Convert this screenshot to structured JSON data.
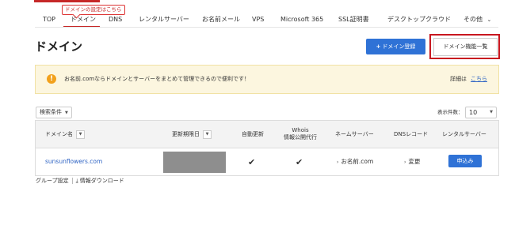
{
  "tooltip": {
    "text": "ドメインの設定はこちら"
  },
  "nav": {
    "items": [
      {
        "label": "TOP"
      },
      {
        "label": "ドメイン"
      },
      {
        "label": "DNS"
      },
      {
        "label": "レンタルサーバー"
      },
      {
        "label": "お名前メール"
      },
      {
        "label": "VPS"
      },
      {
        "label": "Microsoft 365"
      },
      {
        "label": "SSL証明書"
      },
      {
        "label": "デスクトップクラウド"
      },
      {
        "label": "その他"
      }
    ],
    "more_caret": "⌄",
    "active_color": "#c62828"
  },
  "page": {
    "title": "ドメイン"
  },
  "actions": {
    "register_label": "ドメイン登録",
    "register_icon": "plus-icon",
    "functions_label": "ドメイン機能一覧",
    "primary_color": "#2f72d6"
  },
  "notice": {
    "icon": "info-icon",
    "text": "お名前.comならドメインとサーバーをまとめて管理できるので便利です！",
    "detail_prefix": "詳細は",
    "detail_link": "こちら"
  },
  "filter": {
    "label": "検索条件"
  },
  "pagination": {
    "per_page_label": "表示件数：",
    "per_page_value": "10"
  },
  "table": {
    "columns": {
      "domain": "ドメイン名",
      "expiry": "更新期限日",
      "auto_renew": "自動更新",
      "whois_line1": "Whois",
      "whois_line2": "情報公開代行",
      "nameserver": "ネームサーバー",
      "dns": "DNSレコード",
      "rental": "レンタルサーバー"
    },
    "rows": [
      {
        "domain": "sunsunflowers.com",
        "nameserver": "お名前.com",
        "dns": "変更",
        "apply": "申込み"
      }
    ]
  },
  "footer": {
    "group_settings": "グループ設定",
    "download": "情報ダウンロード"
  }
}
